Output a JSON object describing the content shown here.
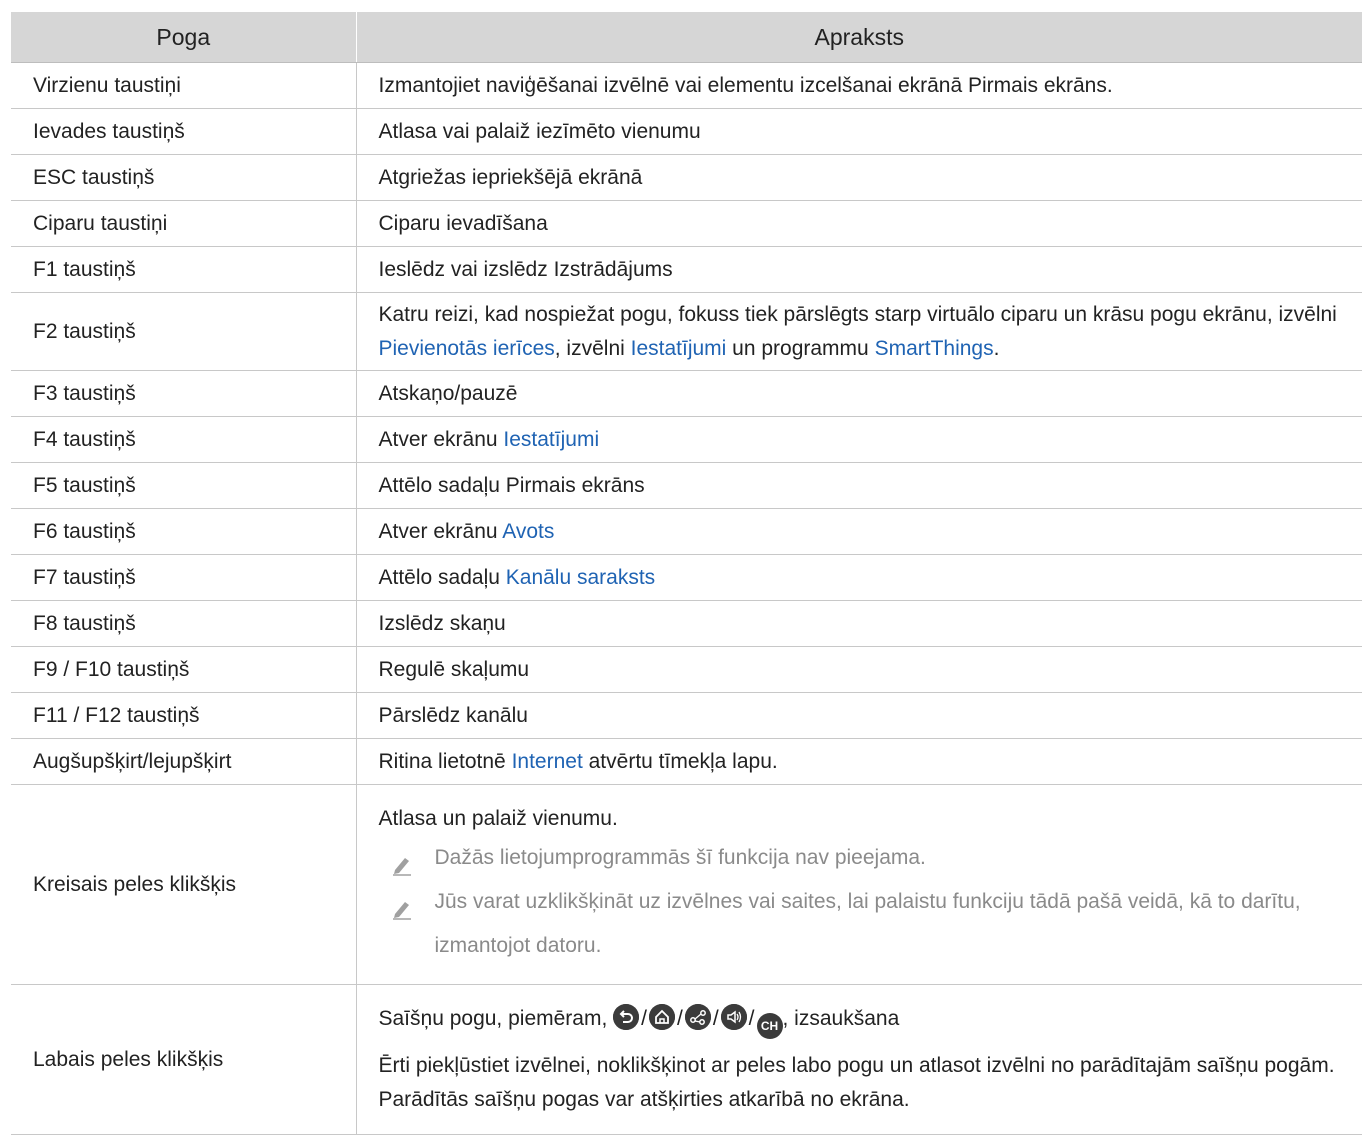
{
  "table": {
    "headers": [
      "Poga",
      "Apraksts"
    ],
    "rows": [
      {
        "key": "Virzienu taustiņi",
        "desc": "Izmantojiet naviģēšanai izvēlnē vai elementu izcelšanai ekrānā Pirmais ekrāns."
      },
      {
        "key": "Ievades taustiņš",
        "desc": "Atlasa vai palaiž iezīmēto vienumu"
      },
      {
        "key": "ESC taustiņš",
        "desc": "Atgriežas iepriekšējā ekrānā"
      },
      {
        "key": "Ciparu taustiņi",
        "desc": "Ciparu ievadīšana"
      },
      {
        "key": "F1 taustiņš",
        "desc": "Ieslēdz vai izslēdz Izstrādājums"
      },
      {
        "key": "F2 taustiņš",
        "desc_a": "Katru reizi, kad nospiežat pogu, fokuss tiek pārslēgts starp virtuālo ciparu un krāsu pogu ekrānu, izvēlni ",
        "link1": "Pievienotās ierīces",
        "desc_b": ", izvēlni ",
        "link2": "Iestatījumi",
        "desc_c": " un programmu ",
        "link3": "SmartThings",
        "desc_d": "."
      },
      {
        "key": "F3 taustiņš",
        "desc": "Atskaņo/pauzē"
      },
      {
        "key": "F4 taustiņš",
        "desc_a": "Atver ekrānu ",
        "link1": "Iestatījumi"
      },
      {
        "key": "F5 taustiņš",
        "desc": "Attēlo sadaļu Pirmais ekrāns"
      },
      {
        "key": "F6 taustiņš",
        "desc_a": "Atver ekrānu ",
        "link1": "Avots"
      },
      {
        "key": "F7 taustiņš",
        "desc_a": "Attēlo sadaļu ",
        "link1": "Kanālu saraksts"
      },
      {
        "key": "F8 taustiņš",
        "desc": "Izslēdz skaņu"
      },
      {
        "key": "F9 / F10 taustiņš",
        "desc": "Regulē skaļumu"
      },
      {
        "key": "F11 / F12 taustiņš",
        "desc": "Pārslēdz kanālu"
      },
      {
        "key": "Augšupšķirt/lejupšķirt",
        "desc_a": "Ritina lietotnē ",
        "link1": "Internet",
        "desc_b": " atvērtu tīmekļa lapu."
      },
      {
        "key": "Kreisais peles klikšķis",
        "desc": "Atlasa un palaiž vienumu.",
        "notes": [
          "Dažās lietojumprogrammās šī funkcija nav pieejama.",
          "Jūs varat uzklikšķināt uz izvēlnes vai saites, lai palaistu funkciju tādā pašā veidā, kā to darītu, izmantojot datoru."
        ]
      },
      {
        "key": "Labais peles klikšķis",
        "desc_a": "Saīšņu pogu, piemēram, ",
        "desc_b": ", izsaukšana",
        "icons": [
          "return-icon",
          "home-icon",
          "share-icon",
          "volume-icon",
          "channel-icon"
        ],
        "channel_label": "CH",
        "separator": "/",
        "desc2": "Ērti piekļūstiet izvēlnei, noklikšķinot ar peles labo pogu un atlasot izvēlni no parādītajām saīšņu pogām. Parādītās saīšņu pogas var atšķirties atkarībā no ekrāna."
      }
    ]
  }
}
